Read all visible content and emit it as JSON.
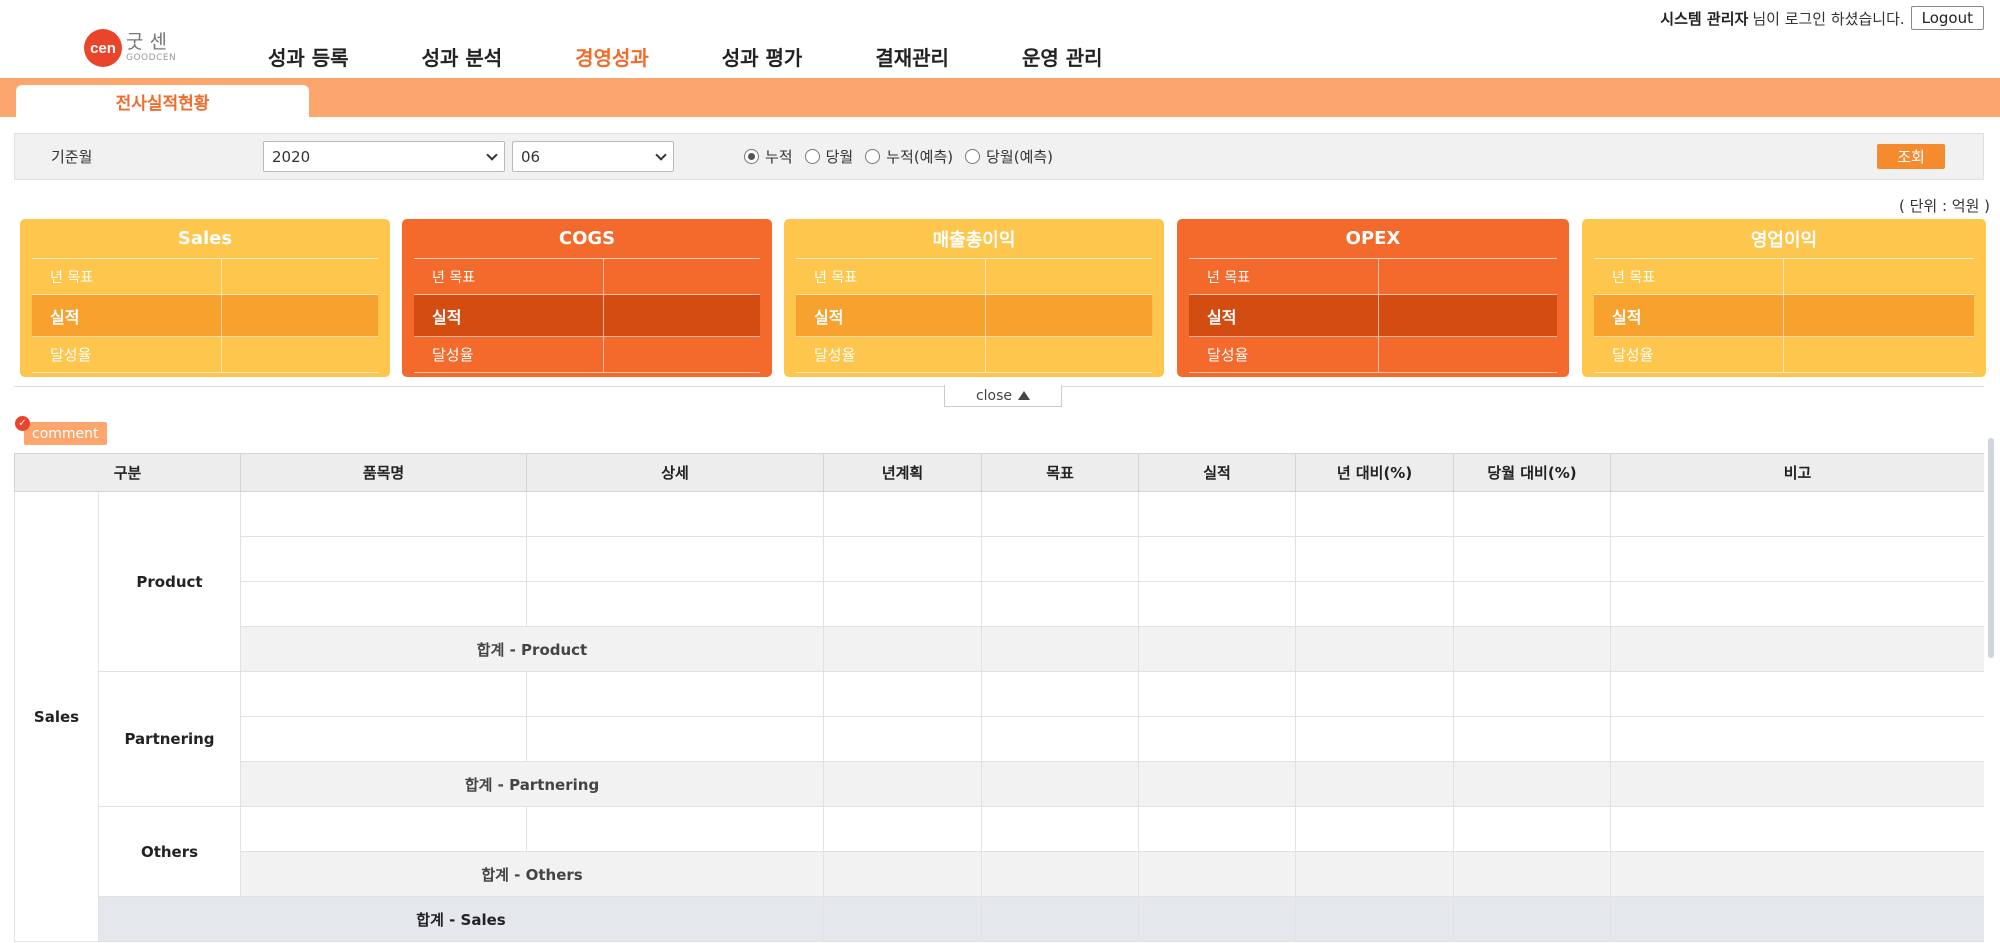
{
  "header": {
    "logo_mark": "cen",
    "logo_kr": "굿센",
    "logo_en": "GOODCEN",
    "nav": [
      "성과 등록",
      "성과 분석",
      "경영성과",
      "성과 평가",
      "결재관리",
      "운영 관리"
    ],
    "active_nav": "경영성과",
    "user_name": "시스템 관리자",
    "user_suffix": "님이 로그인 하셨습니다.",
    "logout_label": "Logout"
  },
  "tab": {
    "label": "전사실적현황"
  },
  "filter": {
    "label": "기준월",
    "year": "2020",
    "month": "06",
    "radios": [
      {
        "label": "누적",
        "checked": true
      },
      {
        "label": "당월",
        "checked": false
      },
      {
        "label": "누적(예측)",
        "checked": false
      },
      {
        "label": "당월(예측)",
        "checked": false
      }
    ],
    "search_label": "조회"
  },
  "unit": "( 단위 : 억원 )",
  "cards": [
    {
      "title": "Sales",
      "theme": "yellow",
      "target_label": "년 목표",
      "actual_label": "실적",
      "rate_label": "달성율"
    },
    {
      "title": "COGS",
      "theme": "orange",
      "target_label": "년 목표",
      "actual_label": "실적",
      "rate_label": "달성율"
    },
    {
      "title": "매출총이익",
      "theme": "yellow",
      "target_label": "년 목표",
      "actual_label": "실적",
      "rate_label": "달성율"
    },
    {
      "title": "OPEX",
      "theme": "orange",
      "target_label": "년 목표",
      "actual_label": "실적",
      "rate_label": "달성율"
    },
    {
      "title": "영업이익",
      "theme": "yellow",
      "target_label": "년 목표",
      "actual_label": "실적",
      "rate_label": "달성율"
    }
  ],
  "close_label": "close",
  "comment_label": "comment",
  "table": {
    "headers": [
      "구분",
      "품목명",
      "상세",
      "년계획",
      "목표",
      "실적",
      "년 대비(%)",
      "당월 대비(%)",
      "비고"
    ],
    "group": "Sales",
    "product": "Product",
    "product_total": "합계 - Product",
    "partnering": "Partnering",
    "partnering_total": "합계 - Partnering",
    "others": "Others",
    "others_total": "합계 - Others",
    "sales_total": "합계 - Sales"
  },
  "colors": {
    "accent": "#f26b2a",
    "tab_bar": "#fca56c",
    "card_yellow": "#fec64c",
    "card_orange": "#f36a2c"
  }
}
